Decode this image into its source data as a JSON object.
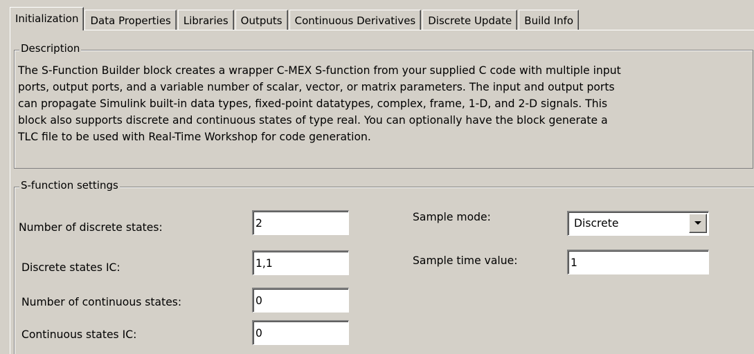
{
  "tabs": [
    {
      "label": "Initialization",
      "active": true
    },
    {
      "label": "Data Properties",
      "active": false
    },
    {
      "label": "Libraries",
      "active": false
    },
    {
      "label": "Outputs",
      "active": false
    },
    {
      "label": "Continuous Derivatives",
      "active": false
    },
    {
      "label": "Discrete Update",
      "active": false
    },
    {
      "label": "Build Info",
      "active": false
    }
  ],
  "description": {
    "title": "Description",
    "lines": [
      "The S-Function Builder block creates a wrapper C-MEX S-function from your supplied C code with multiple input",
      "ports, output ports, and a variable number of scalar, vector, or matrix parameters. The input and output ports",
      "can propagate Simulink built-in data types, fixed-point datatypes, complex, frame, 1-D, and 2-D signals. This",
      "block also supports discrete and continuous states of type real. You can optionally have the block generate a",
      "TLC file to be used with Real-Time Workshop for code generation."
    ]
  },
  "settings": {
    "title": "S-function settings",
    "num_discrete_states": {
      "label": "Number of discrete states:",
      "value": "2"
    },
    "discrete_states_ic": {
      "label": "Discrete states IC:",
      "value": "1,1"
    },
    "num_continuous_states": {
      "label": "Number of continuous states:",
      "value": "0"
    },
    "continuous_states_ic": {
      "label": "Continuous states IC:",
      "value": "0"
    },
    "sample_mode": {
      "label": "Sample mode:",
      "value": "Discrete"
    },
    "sample_time_value": {
      "label": "Sample time value:",
      "value": "1"
    }
  }
}
